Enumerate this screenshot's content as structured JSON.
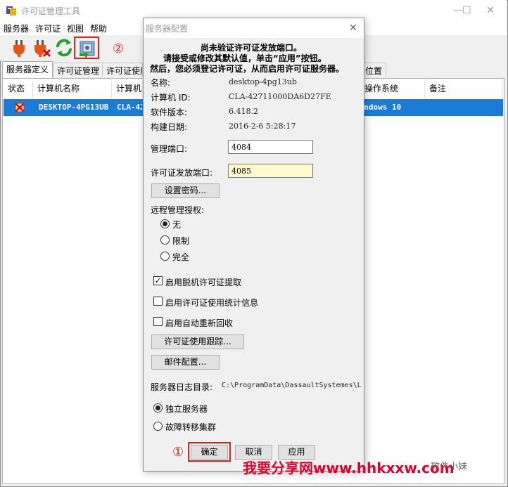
{
  "window": {
    "title": "许可证管理工具",
    "controls": {
      "minimize": "—",
      "maximize": "☐",
      "close": "✕"
    }
  },
  "menu": [
    "服务器",
    "许可证",
    "视图",
    "帮助"
  ],
  "toolbar": {
    "icons": [
      "plug-icon",
      "plug-remove-icon",
      "refresh-icon",
      "server-config-icon"
    ],
    "callout_2": "②"
  },
  "tabs": [
    "服务器定义",
    "许可证管理",
    "许可证使用",
    "位置"
  ],
  "table": {
    "columns": [
      "状态",
      "计算机名称",
      "计算机",
      "操作系统",
      "备注"
    ],
    "row": {
      "name": "DESKTOP-4PG13UB",
      "id": "CLA-42",
      "os": "Windows 10"
    }
  },
  "dialog": {
    "title": "服务器配置",
    "close": "✕",
    "notice": [
      "尚未验证许可证发放端口。",
      "请接受或修改其默认值，单击“应用”按钮。",
      "然后，您必须登记许可证，从而启用许可证服务器。"
    ],
    "info": [
      {
        "label": "名称:",
        "value": "desktop-4pg13ub"
      },
      {
        "label": "计算机 ID:",
        "value": "CLA-42711000DA6D27FE"
      },
      {
        "label": "软件版本:",
        "value": "6.418.2"
      },
      {
        "label": "构建日期:",
        "value": "2016-2-6 5:28:17"
      }
    ],
    "admin_port": {
      "label": "管理端口:",
      "value": "4084"
    },
    "license_port": {
      "label": "许可证发放端口:",
      "value": "4085"
    },
    "set_password": "设置密码...",
    "remote_auth": {
      "label": "远程管理授权:",
      "options": [
        "无",
        "限制",
        "完全"
      ],
      "selected": "无"
    },
    "checkboxes": [
      {
        "label": "启用脱机许可证提取",
        "checked": true,
        "mark": "✓"
      },
      {
        "label": "启用许可证使用统计信息",
        "checked": false,
        "mark": ""
      },
      {
        "label": "启用自动重新回收",
        "checked": false,
        "mark": ""
      }
    ],
    "tracking_button": "许可证使用跟踪...",
    "mail_button": "邮件配置...",
    "log_dir": {
      "label": "服务器日志目录:",
      "value": "C:\\ProgramData\\DassaultSystemes\\L"
    },
    "server_mode": {
      "options": [
        "独立服务器",
        "故障转移集群"
      ],
      "selected": "独立服务器"
    },
    "buttons": {
      "ok": "确定",
      "cancel": "取消",
      "apply": "应用"
    },
    "callout_1": "①"
  },
  "watermark": {
    "red": "我要分享网www.hhkxxw.com",
    "gray": "软件小妹"
  },
  "colors": {
    "selection": "#1a7cd6",
    "callout": "#e02020",
    "highlight_field": "#fffacd"
  }
}
